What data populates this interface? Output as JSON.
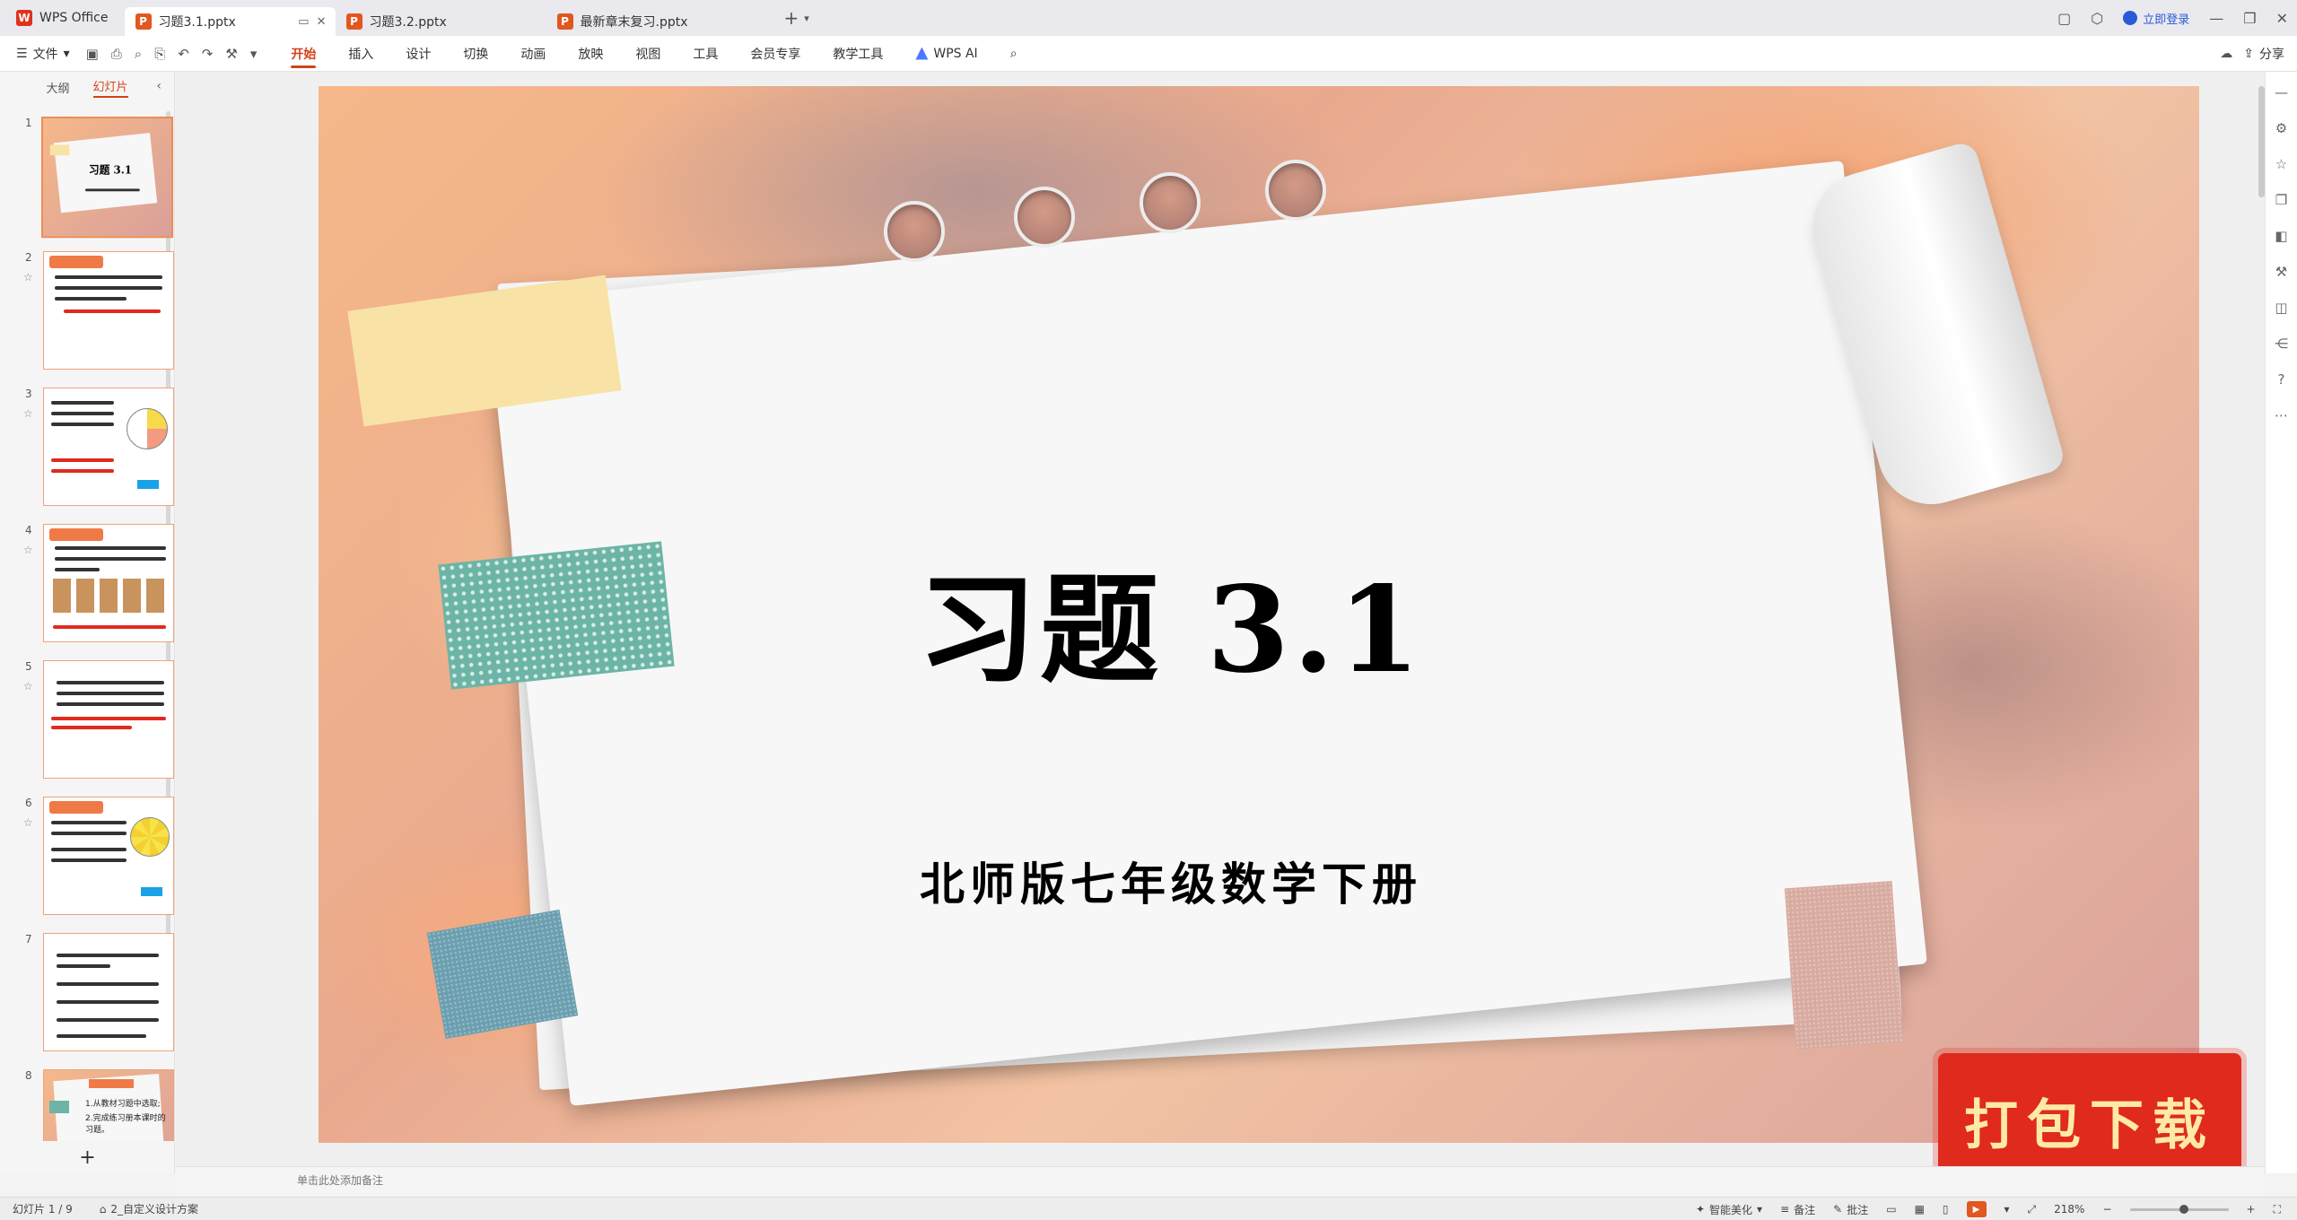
{
  "tabs": {
    "app": "WPS Office",
    "docs": [
      {
        "label": "习题3.1.pptx",
        "active": true
      },
      {
        "label": "习题3.2.pptx",
        "active": false
      },
      {
        "label": "最新章末复习.pptx",
        "active": false
      }
    ],
    "login": "立即登录"
  },
  "ribbon": {
    "file": "文件",
    "menus": [
      "开始",
      "插入",
      "设计",
      "切换",
      "动画",
      "放映",
      "视图",
      "工具",
      "会员专享",
      "教学工具",
      "WPS AI"
    ],
    "active_menu": "开始",
    "share": "分享"
  },
  "panel": {
    "tabs": [
      "大纲",
      "幻灯片"
    ],
    "active_tab": "幻灯片",
    "slide_numbers": [
      "1",
      "2",
      "3",
      "4",
      "5",
      "6",
      "7",
      "8"
    ],
    "slide8_lines": [
      "1.从教材习题中选取;",
      "2.完成练习册本课时的习题。"
    ]
  },
  "slide": {
    "title": "习题 3.1",
    "subtitle": "北师版七年级数学下册",
    "watermark": "打包下载"
  },
  "notes": {
    "placeholder": "单击此处添加备注"
  },
  "status": {
    "slide_counter": "幻灯片 1 / 9",
    "design_scheme": "2_自定义设计方案",
    "smart_beautify": "智能美化",
    "notes_label": "备注",
    "comments_label": "批注",
    "zoom": "218%",
    "zoom_fraction": 0.55
  },
  "colors": {
    "accent": "#d3431b",
    "thumb_border": "#ed8a52",
    "watermark_bg": "#e02a1e"
  }
}
